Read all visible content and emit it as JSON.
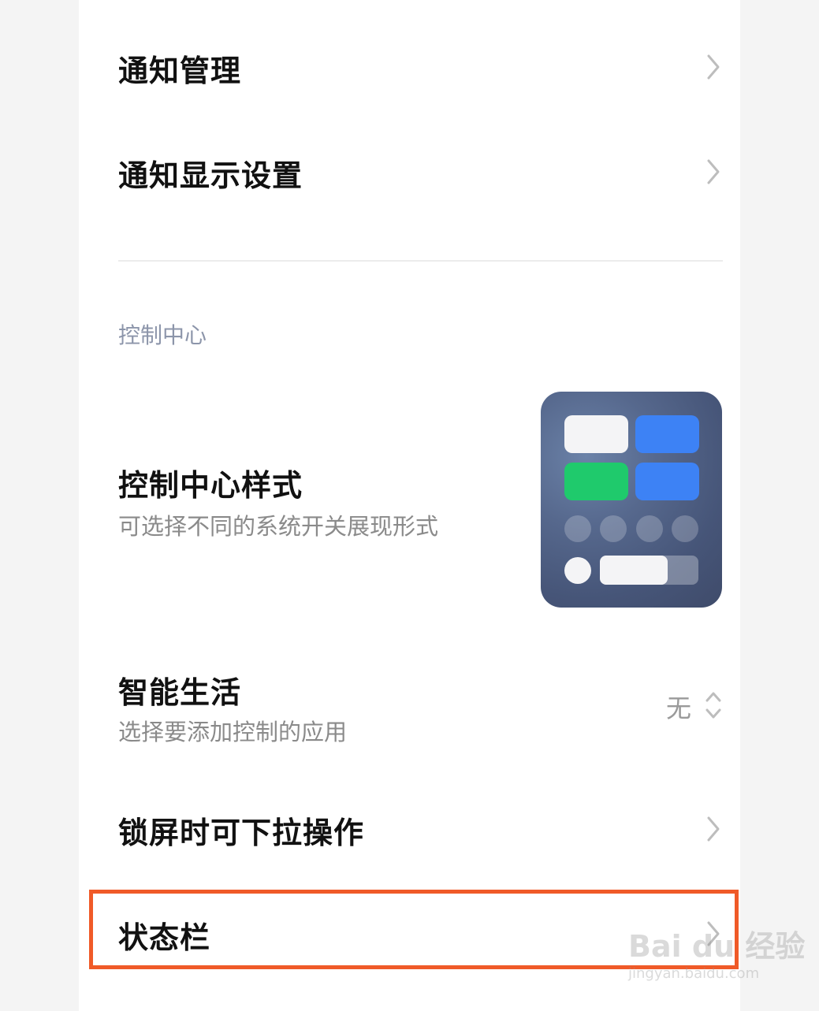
{
  "notifications": {
    "management_label": "通知管理",
    "display_settings_label": "通知显示设置"
  },
  "control_center": {
    "section_title": "控制中心",
    "style": {
      "title": "控制中心样式",
      "subtitle": "可选择不同的系统开关展现形式"
    },
    "smart_life": {
      "title": "智能生活",
      "subtitle": "选择要添加控制的应用",
      "value": "无"
    },
    "lockscreen_pulldown_label": "锁屏时可下拉操作",
    "status_bar_label": "状态栏"
  },
  "watermark": {
    "brand": "Bai du 经验",
    "url": "jingyan.baidu.com"
  },
  "colors": {
    "highlight_border": "#f05a28",
    "section_header": "#8c95aa",
    "tile_blue": "#3d82f5",
    "tile_green": "#1fca6c"
  },
  "icons": {
    "chevron": "chevron-right-icon",
    "updown": "up-down-arrow-icon"
  }
}
